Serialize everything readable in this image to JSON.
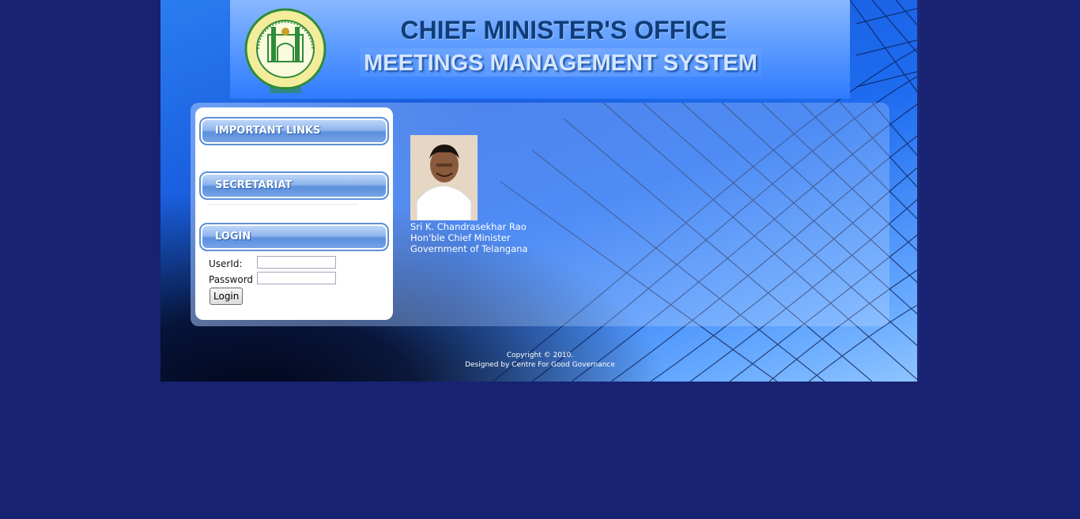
{
  "header": {
    "title": "CHIEF MINISTER'S OFFICE",
    "subtitle": "MEETINGS MANAGEMENT SYSTEM",
    "emblem_icon": "telangana-government-emblem"
  },
  "sidebar": {
    "sections": [
      {
        "label": "IMPORTANT LINKS"
      },
      {
        "label": "SECRETARIAT"
      },
      {
        "label": "LOGIN"
      }
    ],
    "login": {
      "userid_label": "UserId:",
      "userid_value": "",
      "password_label": "Password :",
      "password_value": "",
      "button_label": "Login"
    }
  },
  "main": {
    "person": {
      "name": "Sri K. Chandrasekhar Rao",
      "title": "Hon'ble Chief Minister",
      "org": "Government of Telangana"
    }
  },
  "footer": {
    "copyright": "Copyright © 2010.",
    "designed_by": "Designed by Centre For Good Governance"
  },
  "colors": {
    "page_background": "#172272",
    "title_color": "#0f3d7a",
    "subtitle_color": "#d4e6ff",
    "section_header": "#7aa6e8"
  }
}
